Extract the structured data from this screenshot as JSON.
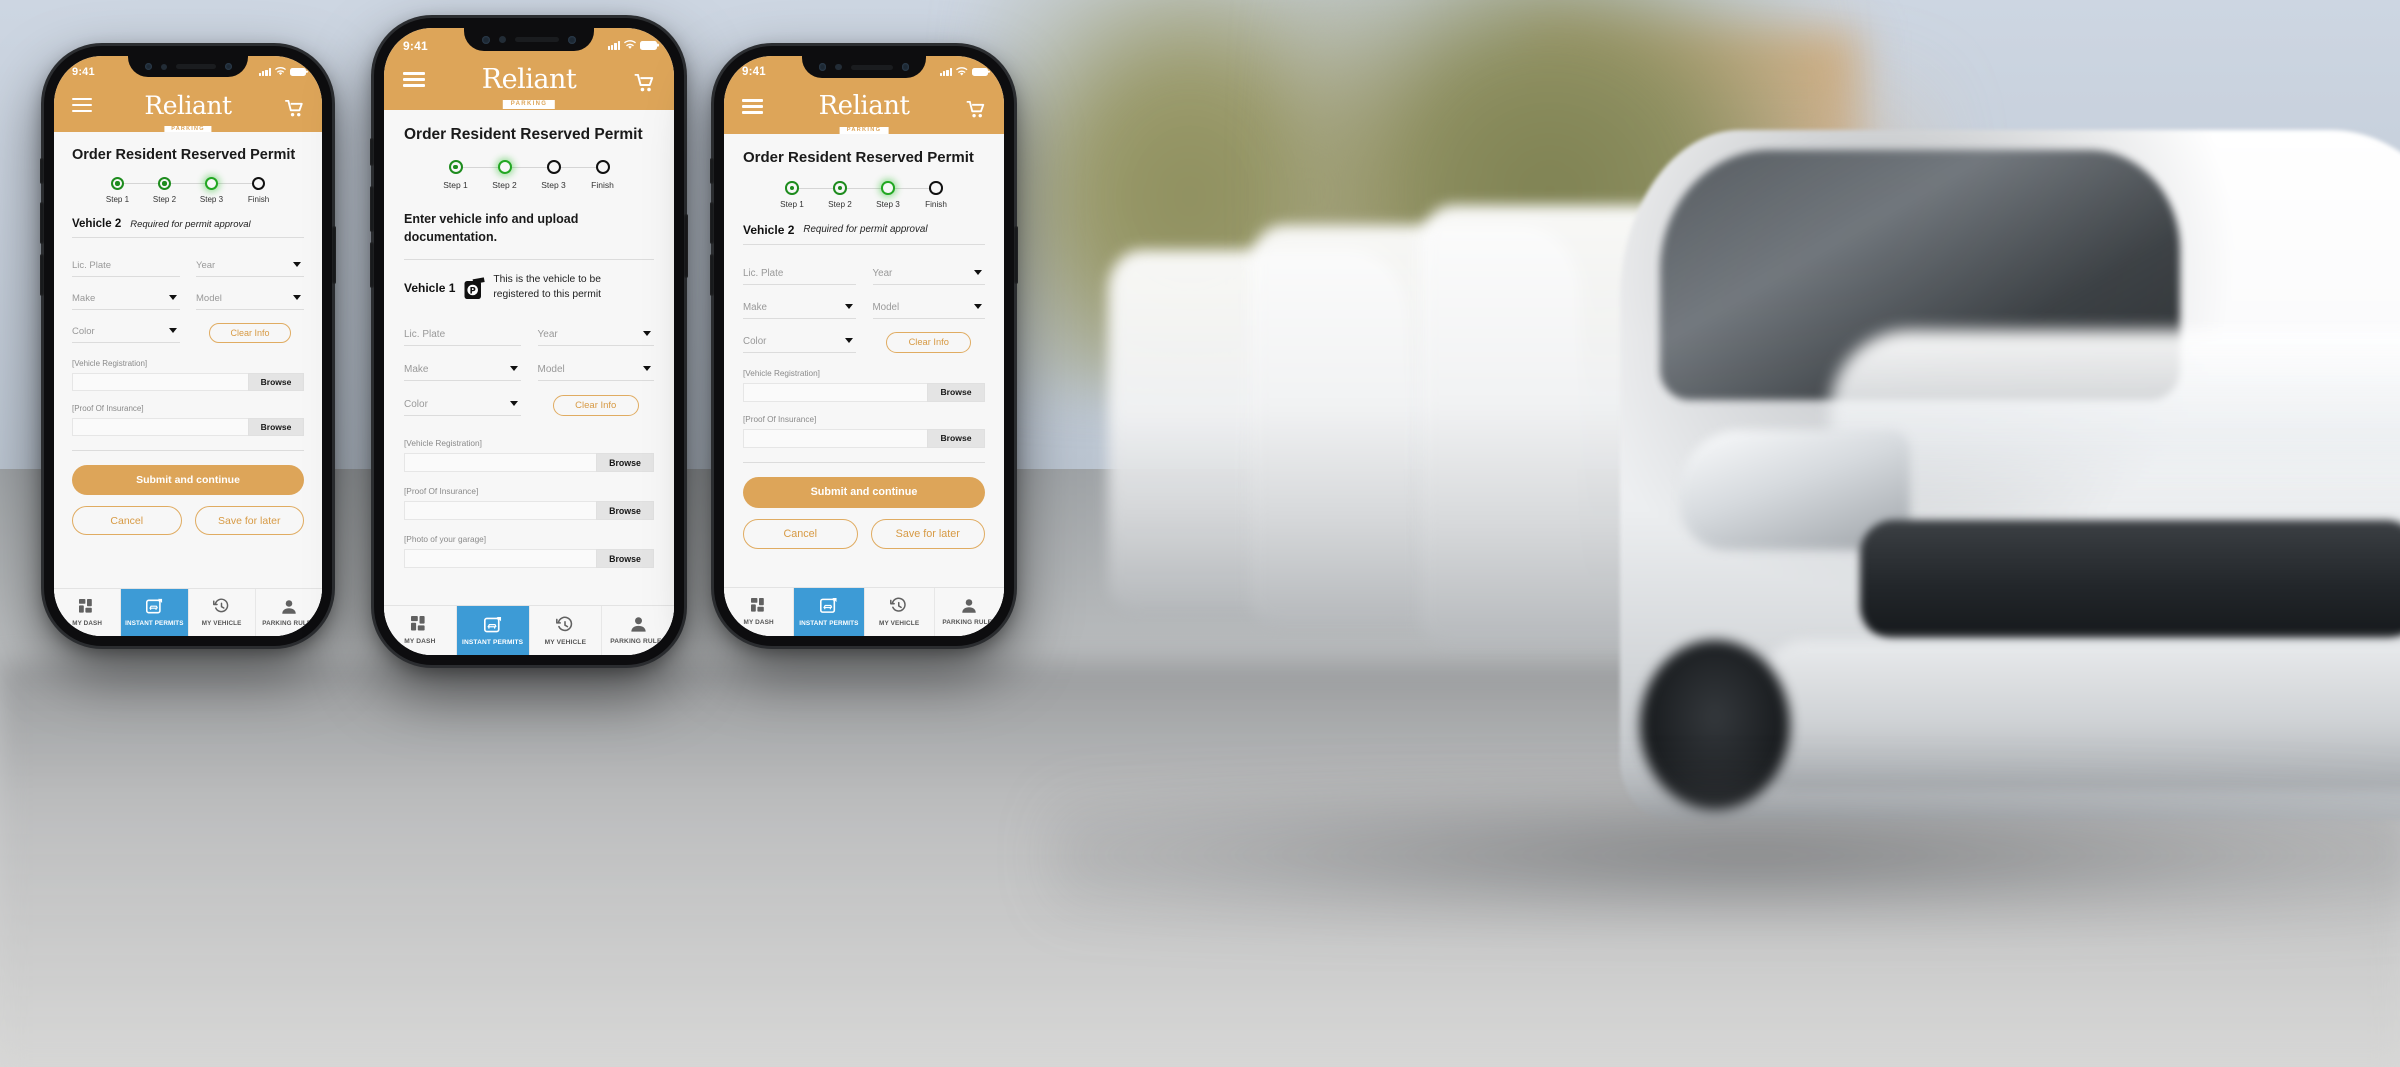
{
  "brand": {
    "logo_main": "Reliant",
    "logo_sub": "PARKING",
    "accent": "#dda559",
    "accent_outline": "#d79a44",
    "nav_active": "#3d9bd6",
    "step_done": "#1e8c1e",
    "step_current": "#22a722"
  },
  "status_bar": {
    "time": "9:41"
  },
  "header": {
    "menu_icon": "hamburger-icon",
    "cart_icon": "shopping-cart-icon"
  },
  "page": {
    "title": "Order Resident Reserved Permit"
  },
  "stepper": {
    "left": {
      "steps": [
        {
          "label": "Step 1",
          "state": "done"
        },
        {
          "label": "Step 2",
          "state": "done"
        },
        {
          "label": "Step 3",
          "state": "current"
        },
        {
          "label": "Finish",
          "state": "todo"
        }
      ]
    },
    "center": {
      "steps": [
        {
          "label": "Step 1",
          "state": "done"
        },
        {
          "label": "Step 2",
          "state": "current"
        },
        {
          "label": "Step 3",
          "state": "todo"
        },
        {
          "label": "Finish",
          "state": "todo"
        }
      ]
    }
  },
  "center_phone": {
    "lead": "Enter vehicle info and upload documentation.",
    "vehicle_title": "Vehicle 1",
    "vehicle_icon": "parking-permit-icon",
    "vehicle_note_line1": "This is the vehicle to be",
    "vehicle_note_line2": "registered to this permit",
    "fields": {
      "lic_plate": "Lic. Plate",
      "year": "Year",
      "make": "Make",
      "model": "Model",
      "color": "Color"
    },
    "clear_info": "Clear Info",
    "uploads": [
      {
        "label": "[Vehicle Registration]",
        "value": "",
        "button": "Browse"
      },
      {
        "label": "[Proof Of Insurance]",
        "value": "",
        "button": "Browse"
      },
      {
        "label": "[Photo of your garage]",
        "value": "",
        "button": "Browse"
      }
    ]
  },
  "side_phone": {
    "vehicle_title": "Vehicle 2",
    "vehicle_note": "Required for permit approval",
    "fields": {
      "lic_plate": "Lic. Plate",
      "year": "Year",
      "make": "Make",
      "model": "Model",
      "color": "Color"
    },
    "clear_info": "Clear Info",
    "uploads": [
      {
        "label": "[Vehicle Registration]",
        "value": "",
        "button": "Browse"
      },
      {
        "label": "[Proof Of Insurance]",
        "value": "",
        "button": "Browse"
      }
    ],
    "actions": {
      "submit": "Submit and continue",
      "cancel": "Cancel",
      "save": "Save for later"
    }
  },
  "bottom_nav": {
    "items": [
      {
        "label": "MY DASH",
        "icon": "dashboard-grid-icon",
        "active": false
      },
      {
        "label": "INSTANT PERMITS",
        "icon": "instant-permit-car-icon",
        "active": true
      },
      {
        "label": "MY VEHICLE",
        "icon": "history-clock-icon",
        "active": false
      },
      {
        "label": "PARKING RULES",
        "icon": "person-icon",
        "active": false
      }
    ]
  }
}
